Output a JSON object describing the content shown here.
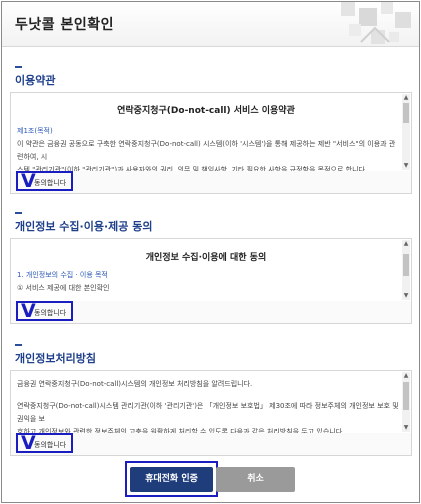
{
  "header": {
    "title": "두낫콜 본인확인"
  },
  "sections": [
    {
      "title": "이용약관",
      "box_title": "연락중지청구(Do-not-call) 서비스 이용약관",
      "lines": [
        "제1조(목적)",
        "이 약관은 금융권 공동으로 구축한 연락중지청구(Do-not-call) 시스템(이하 '시스템')을 통해 제공하는 제반 \"서비스\"의 이용과 관련하여, 시",
        "스템 \"관리기관\"(이하 \"관리기관\")과 사용자와의 권리, 의무 및 책임사항, 기타 필요한 사항을 규정함을 목적으로 합니다."
      ],
      "agree_label": "동의합니다"
    },
    {
      "title": "개인정보 수집·이용·제공 동의",
      "box_title": "개인정보 수집·이용에 대한 동의",
      "lines": [
        "1. 개인정보의 수집 · 이용 목적",
        "① 서비스 제공에 대한 본인확인"
      ],
      "agree_label": "동의합니다"
    },
    {
      "title": "개인정보처리방침",
      "box_title": "",
      "lines": [
        "금융권 연락중지청구(Do-not-call)시스템의 개인정보 처리방침을 알려드립니다.",
        "연락중지청구(Do-not-call)시스템 관리기관(이하 '관리기관')은 「개인정보 보호법」 제30조에 따라 정보주체의 개인정보 보호 및 권익을 보",
        "호하고 개인정보와 관련한 정보주체의 고충을 원활하게 처리할 수 있도록 다음과 같은 처리방침을 두고 있습니다."
      ],
      "agree_label": "동의합니다"
    }
  ],
  "buttons": {
    "confirm": "휴대전화 인증",
    "cancel": "취소"
  },
  "colors": {
    "primary": "#1f3d7a",
    "highlight": "#1a1ec0",
    "section_title": "#1e3f8a",
    "cancel": "#9a9a9a"
  },
  "icons": {
    "check": "check-mark-icon"
  }
}
